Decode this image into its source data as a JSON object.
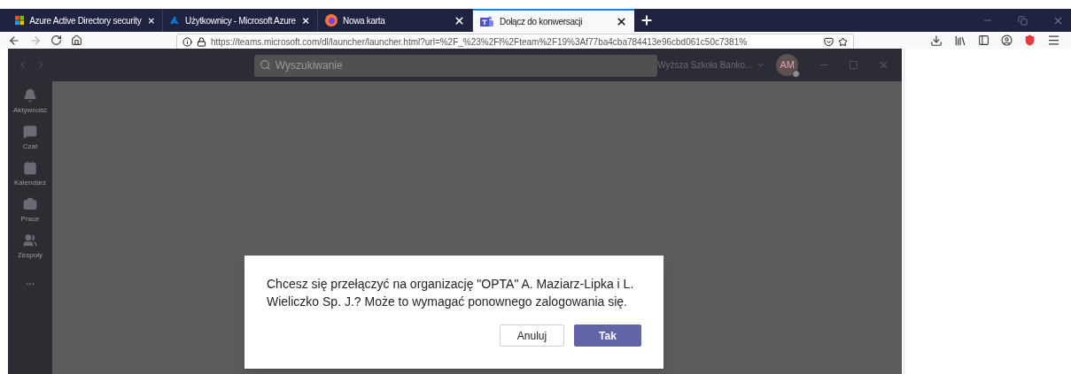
{
  "browser_tabs": [
    {
      "title": "Azure Active Directory security",
      "kind": "windows",
      "selected": false
    },
    {
      "title": "Użytkownicy - Microsoft Azure",
      "kind": "azure",
      "selected": false
    },
    {
      "title": "Nowa karta",
      "kind": "firefox",
      "selected": false
    },
    {
      "title": "Dołącz do konwersacji",
      "kind": "teams",
      "selected": true
    }
  ],
  "address_bar": {
    "url": "https://teams.microsoft.com/dl/launcher/launcher.html?url=%2F_%23%2Fl%2Fteam%2F19%3Af77ba4cba784413e96cbd061c50c7381%"
  },
  "teams": {
    "search": {
      "placeholder": "Wyszukiwanie"
    },
    "organization": "Wyższa Szkoła Banko...",
    "avatar": "AM",
    "sidebar": [
      {
        "label": "Aktywność",
        "kind": "bell"
      },
      {
        "label": "Czat",
        "kind": "chat"
      },
      {
        "label": "Kalendarz",
        "kind": "calendar"
      },
      {
        "label": "Prace",
        "kind": "bag"
      },
      {
        "label": "Zespoły",
        "kind": "teams"
      },
      {
        "label": "...",
        "kind": "more"
      }
    ]
  },
  "dialog": {
    "message": "Chcesz się przełączyć na organizację \"OPTA\" A. Maziarz-Lipka i L. Wieliczko Sp. J.? Może to wymagać ponownego zalogowania się.",
    "buttons": [
      {
        "label": "Anuluj",
        "kind": "secondary"
      },
      {
        "label": "Tak",
        "kind": "primary"
      }
    ]
  }
}
